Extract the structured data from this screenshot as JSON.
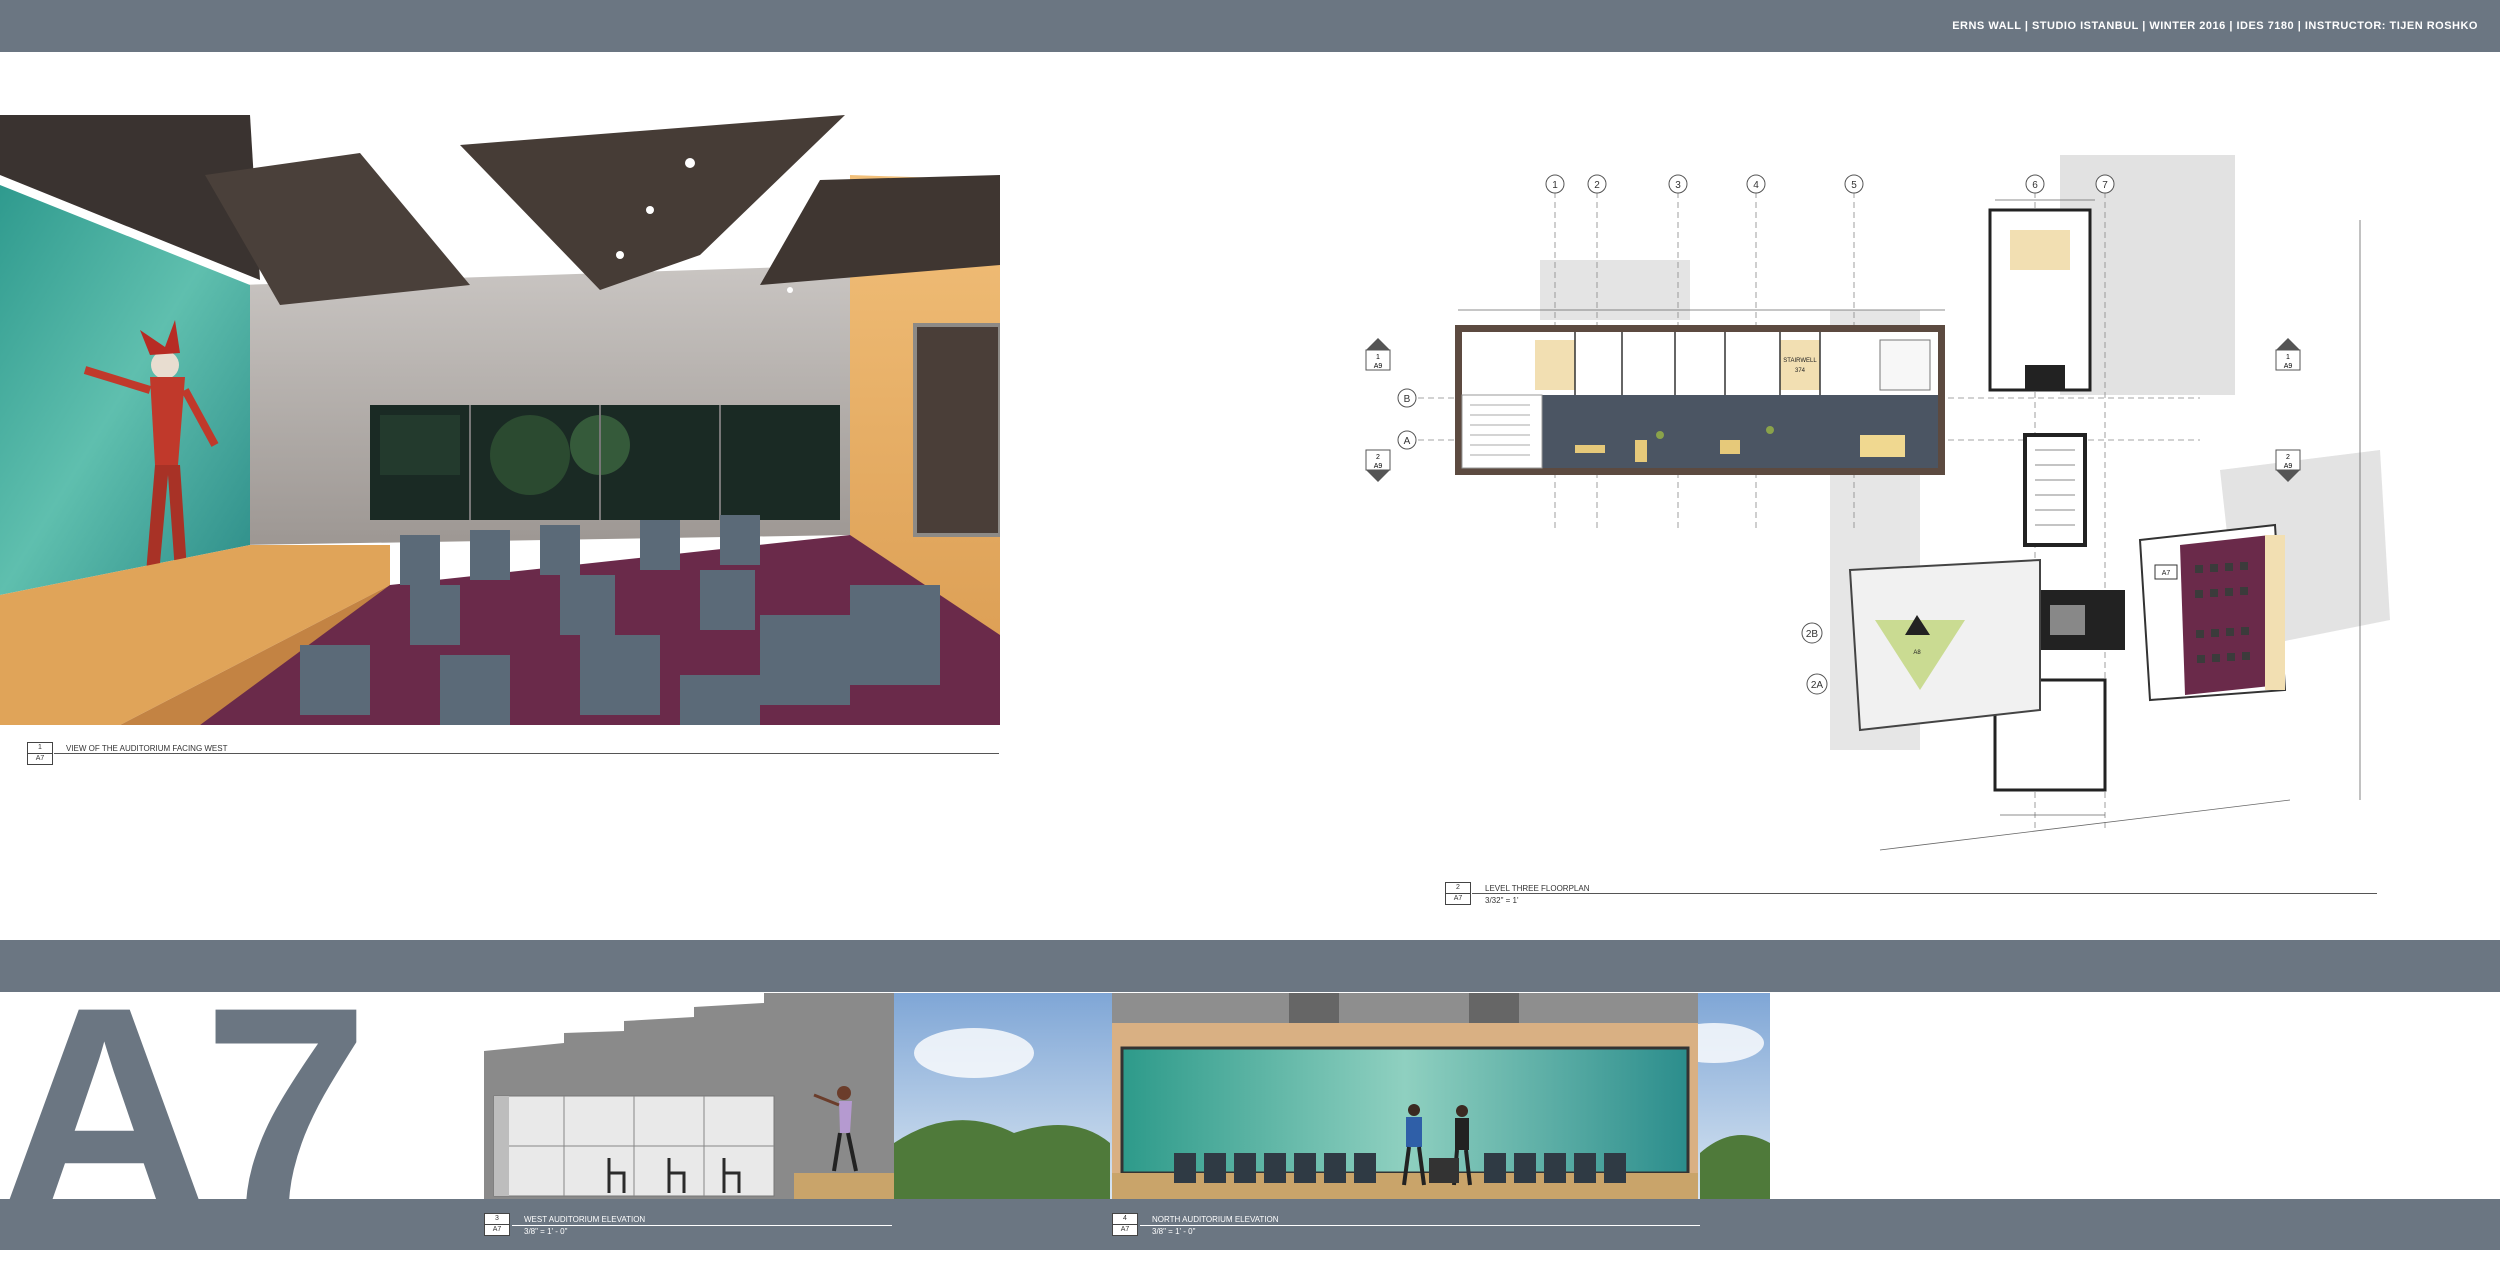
{
  "header": {
    "title_block": "ERNS WALL | STUDIO ISTANBUL | WINTER 2016 | IDES 7180 | INSTRUCTOR: TIJEN ROSHKO"
  },
  "sheet": {
    "number": "A7"
  },
  "views": [
    {
      "number": "1",
      "sheet": "A7",
      "title": "VIEW OF THE AUDITORIUM FACING WEST",
      "scale": ""
    },
    {
      "number": "2",
      "sheet": "A7",
      "title": "LEVEL THREE FLOORPLAN",
      "scale": "3/32\" = 1'"
    },
    {
      "number": "3",
      "sheet": "A7",
      "title": "WEST AUDITORIUM ELEVATION",
      "scale": "3/8\" = 1' - 0\""
    },
    {
      "number": "4",
      "sheet": "A7",
      "title": "NORTH AUDITORIUM ELEVATION",
      "scale": "3/8\" = 1' - 0\""
    }
  ],
  "floorplan": {
    "grid_labels": [
      "1",
      "2",
      "3",
      "4",
      "5",
      "6",
      "7"
    ],
    "row_labels": [
      "B",
      "A",
      "2B",
      "2A"
    ],
    "section_markers": [
      {
        "num": "1",
        "sheet": "A9"
      },
      {
        "num": "2",
        "sheet": "A9"
      },
      {
        "num": "1",
        "sheet": "A9"
      },
      {
        "num": "2",
        "sheet": "A9"
      }
    ],
    "room_label": "STAIRWELL",
    "room_number": "374",
    "auditorium_tag": "A7",
    "callout_tag": "A8"
  },
  "colors": {
    "band": "#6b7682",
    "carpet": "#6a2a4a",
    "wall_warm": "#e7a95c",
    "chair": "#5b6a78",
    "screen_teal": "#3fa8a0"
  }
}
